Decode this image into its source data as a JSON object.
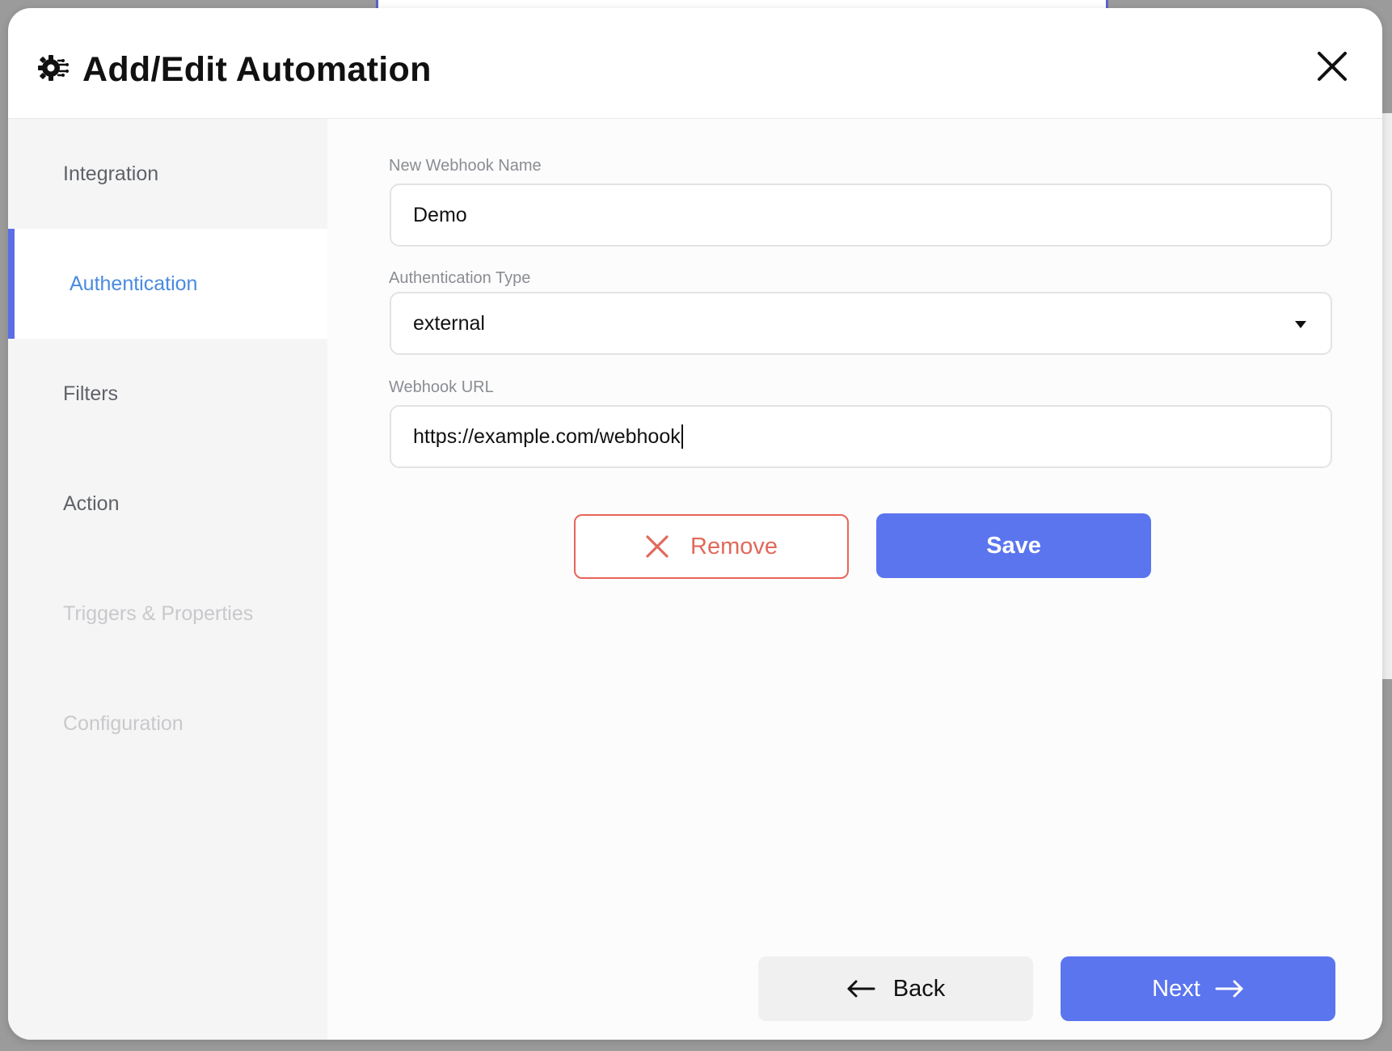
{
  "modal": {
    "title": "Add/Edit Automation"
  },
  "sidebar": {
    "steps": [
      {
        "label": "Integration"
      },
      {
        "label": "Authentication"
      },
      {
        "label": "Filters"
      },
      {
        "label": "Action"
      },
      {
        "label": "Triggers & Properties"
      },
      {
        "label": "Configuration"
      }
    ]
  },
  "form": {
    "webhook_name": {
      "label": "New Webhook Name",
      "value": "Demo"
    },
    "auth_type": {
      "label": "Authentication Type",
      "value": "external"
    },
    "webhook_url": {
      "label": "Webhook URL",
      "value": "https://example.com/webhook"
    }
  },
  "actions": {
    "remove_label": "Remove",
    "save_label": "Save"
  },
  "footer": {
    "back_label": "Back",
    "next_label": "Next"
  },
  "colors": {
    "accent": "#5b75ef",
    "active_step_text": "#4a8ae0",
    "danger": "#e86459"
  }
}
